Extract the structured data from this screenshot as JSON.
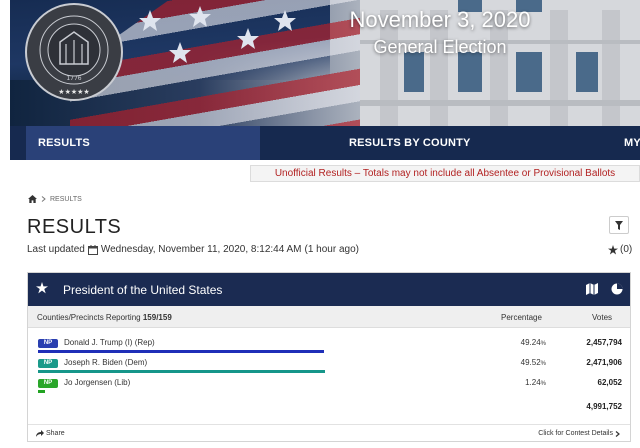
{
  "banner": {
    "date": "November 3, 2020",
    "subtitle": "General Election",
    "seal_text_top": "GEORGIA SECRETARY OF STATE",
    "seal_text_ring": "STATE OF GEORGIA",
    "seal_year": "1776"
  },
  "nav": {
    "results": "RESULTS",
    "results_by_county": "RESULTS BY COUNTY",
    "more": "MY"
  },
  "notice": "Unofficial Results – Totals may not include all Absentee or Provisional Ballots",
  "breadcrumb": {
    "current": "RESULTS"
  },
  "page_title": "RESULTS",
  "updated": {
    "label": "Last updated",
    "datetime": "Wednesday, November 11, 2020, 8:12:44 AM",
    "relative": "(1 hour ago)"
  },
  "favorites_count": "(0)",
  "contest": {
    "title": "President of the United States",
    "reporting_label": "Counties/Precincts Reporting",
    "reporting_value": "159/159",
    "percentage_header": "Percentage",
    "votes_header": "Votes",
    "candidates": [
      {
        "badge": "NP",
        "badge_color": "#2a3fb0",
        "name": "Donald J. Trump (I) (Rep)",
        "pct_num": "49.24",
        "pct_sign": "%",
        "votes": "2,457,794",
        "bar_color": "#1f2fb8",
        "pct_value": 49.24
      },
      {
        "badge": "NP",
        "badge_color": "#1a9a8a",
        "name": "Joseph R. Biden (Dem)",
        "pct_num": "49.52",
        "pct_sign": "%",
        "votes": "2,471,906",
        "bar_color": "#16968a",
        "pct_value": 49.52
      },
      {
        "badge": "NP",
        "badge_color": "#2aa62a",
        "name": "Jo Jorgensen (Lib)",
        "pct_num": "1.24",
        "pct_sign": "%",
        "votes": "62,052",
        "bar_color": "#22a322",
        "pct_value": 1.24
      }
    ],
    "total_votes": "4,991,752",
    "share_label": "Share",
    "details_label": "Click for Contest Details"
  },
  "colors": {
    "nav_bg": "#16294f",
    "nav_active": "#2a4178",
    "notice_text": "#b22222",
    "card_header": "#1b2b52"
  },
  "icons": [
    "home-icon",
    "chevron-right-icon",
    "filter-icon",
    "calendar-icon",
    "star-icon",
    "map-icon",
    "pie-chart-icon",
    "share-icon",
    "chevron-right-icon"
  ]
}
